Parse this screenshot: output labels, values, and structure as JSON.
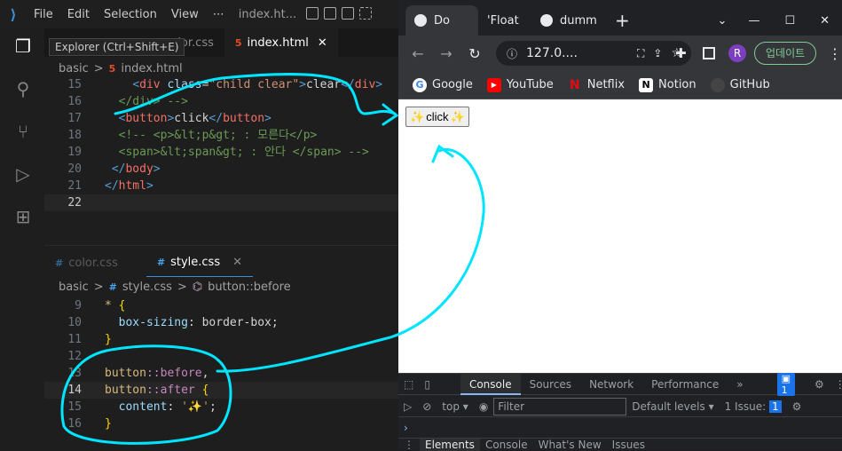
{
  "vscode": {
    "menu": [
      "File",
      "Edit",
      "Selection",
      "View",
      "⋯",
      "index.ht..."
    ],
    "tooltip": "Explorer (Ctrl+Shift+E)",
    "top_tabs": [
      {
        "label": "color.css",
        "icon": "css-file-icon",
        "active": false
      },
      {
        "label": "index.html",
        "icon": "html-file-icon",
        "active": true
      }
    ],
    "top_breadcrumb": [
      "basic",
      ">",
      "index.html"
    ],
    "html_lines": [
      {
        "n": "15",
        "code": "    <div class=\"child clear\">clear</div>"
      },
      {
        "n": "16",
        "code": "  </div> -->"
      },
      {
        "n": "17",
        "code": "  <button>click</button>"
      },
      {
        "n": "18",
        "code": "  <!-- <p>&lt;p&gt; : 모른다</p>"
      },
      {
        "n": "19",
        "code": "  <span>&lt;span&gt; : 안다 </span> -->"
      },
      {
        "n": "20",
        "code": " </body>"
      },
      {
        "n": "21",
        "code": "</html>"
      },
      {
        "n": "22",
        "code": ""
      }
    ],
    "bottom_tabs": [
      {
        "label": "color.css",
        "icon": "css-file-icon",
        "active": false
      },
      {
        "label": "style.css",
        "icon": "css-file-icon",
        "active": true
      }
    ],
    "bottom_breadcrumb": [
      "basic",
      ">",
      "style.css",
      ">",
      "button::before"
    ],
    "css_lines": [
      {
        "n": "9",
        "code": "* {"
      },
      {
        "n": "10",
        "code": "  box-sizing: border-box;"
      },
      {
        "n": "11",
        "code": "}"
      },
      {
        "n": "12",
        "code": ""
      },
      {
        "n": "13",
        "code": "button::before,"
      },
      {
        "n": "14",
        "code": "button::after {"
      },
      {
        "n": "15",
        "code": "  content: '✨';"
      },
      {
        "n": "16",
        "code": "}"
      }
    ]
  },
  "chrome": {
    "tabs": [
      {
        "label": "Do",
        "active": true
      },
      {
        "label": "'Float",
        "active": false
      },
      {
        "label": "dumm",
        "active": false
      }
    ],
    "new_tab": "+",
    "url": "127.0....",
    "profile_initial": "R",
    "update_label": "업데이트",
    "bookmarks": [
      {
        "label": "Google",
        "icon": "google-icon",
        "color": "#4285f4"
      },
      {
        "label": "YouTube",
        "icon": "youtube-icon",
        "color": "#ff0000"
      },
      {
        "label": "Netflix",
        "icon": "netflix-icon",
        "color": "#e50914"
      },
      {
        "label": "Notion",
        "icon": "notion-icon",
        "color": "#ffffff"
      },
      {
        "label": "GitHub",
        "icon": "github-icon",
        "color": "#444444"
      }
    ],
    "page_button": {
      "before": "✨",
      "label": "click",
      "after": "✨"
    },
    "devtools": {
      "tabs": [
        "Console",
        "Sources",
        "Network",
        "Performance",
        "»"
      ],
      "active_tab": "Console",
      "message_count": "1",
      "context": "top",
      "filter_placeholder": "Filter",
      "levels": "Default levels",
      "issues": "1 Issue:",
      "issue_count": "1",
      "drawer_tabs": [
        "Elements",
        "Console",
        "What's New",
        "Issues"
      ]
    }
  },
  "annotation_color": "#00e5ff"
}
